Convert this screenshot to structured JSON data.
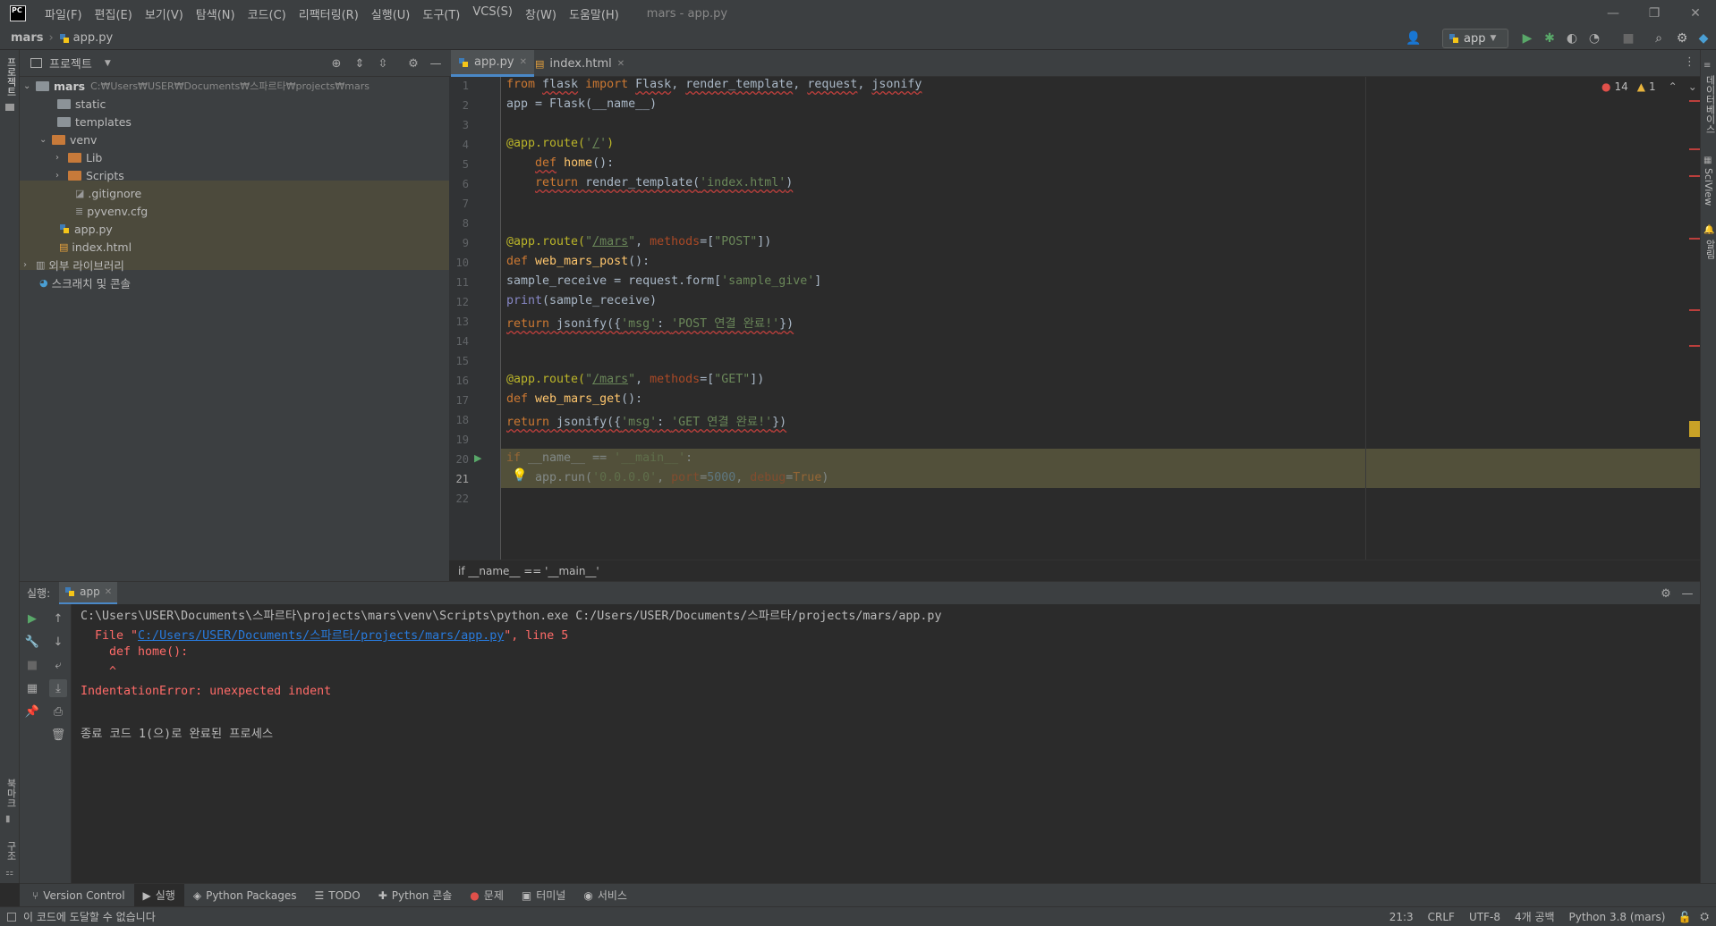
{
  "titlebar": {
    "logo": "PC",
    "menus": [
      "파일(F)",
      "편집(E)",
      "보기(V)",
      "탐색(N)",
      "코드(C)",
      "리팩터링(R)",
      "실행(U)",
      "도구(T)",
      "VCS(S)",
      "창(W)",
      "도움말(H)"
    ],
    "window_title": "mars - app.py"
  },
  "navbar": {
    "project": "mars",
    "file": "app.py",
    "run_config": "app"
  },
  "left_stripe": {
    "project_label": "프로젝트",
    "bookmarks_label": "북마크",
    "structure_label": "구조"
  },
  "right_stripe": {
    "database_label": "데이터베이스",
    "sciview_label": "SciView",
    "notifications_label": "알림"
  },
  "project_panel": {
    "title": "프로젝트",
    "root_name": "mars",
    "root_path": "C:₩Users₩USER₩Documents₩스파르타₩projects₩mars",
    "items": [
      {
        "name": "static"
      },
      {
        "name": "templates"
      },
      {
        "name": "venv"
      },
      {
        "name": "Lib"
      },
      {
        "name": "Scripts"
      },
      {
        "name": ".gitignore"
      },
      {
        "name": "pyvenv.cfg"
      },
      {
        "name": "app.py"
      },
      {
        "name": "index.html"
      },
      {
        "name": "외부 라이브러리"
      },
      {
        "name": "스크래치 및 콘솔"
      }
    ]
  },
  "editor": {
    "tabs": [
      {
        "label": "app.py"
      },
      {
        "label": "index.html"
      }
    ],
    "inspection": {
      "errors": "14",
      "warnings": "1"
    },
    "line_numbers": [
      "1",
      "2",
      "3",
      "4",
      "5",
      "6",
      "7",
      "8",
      "9",
      "10",
      "11",
      "12",
      "13",
      "14",
      "15",
      "16",
      "17",
      "18",
      "19",
      "20",
      "21",
      "22"
    ],
    "breadcrumb": "if __name__ == '__main__'"
  },
  "run_panel": {
    "label": "실행:",
    "tab": "app",
    "output": [
      "C:\\Users\\USER\\Documents\\스파르타\\projects\\mars\\venv\\Scripts\\python.exe C:/Users/USER/Documents/스파르타/projects/mars/app.py",
      "  File \"",
      "C:/Users/USER/Documents/스파르타/projects/mars/app.py",
      "\", line 5",
      "    def home():",
      "    ^",
      "IndentationError: unexpected indent",
      "종료 코드 1(으)로 완료된 프로세스"
    ]
  },
  "tool_windows": [
    "Version Control",
    "실행",
    "Python Packages",
    "TODO",
    "Python 콘솔",
    "문제",
    "터미널",
    "서비스"
  ],
  "statusbar": {
    "message": "이 코드에 도달할 수 없습니다",
    "position": "21:3",
    "line_sep": "CRLF",
    "encoding": "UTF-8",
    "indent": "4개 공백",
    "interpreter": "Python 3.8 (mars)"
  },
  "colors": {
    "accent": "#4a88c7",
    "error": "#ff6b68",
    "keyword": "#cc7832",
    "string": "#6a8759",
    "function": "#ffc66d"
  }
}
